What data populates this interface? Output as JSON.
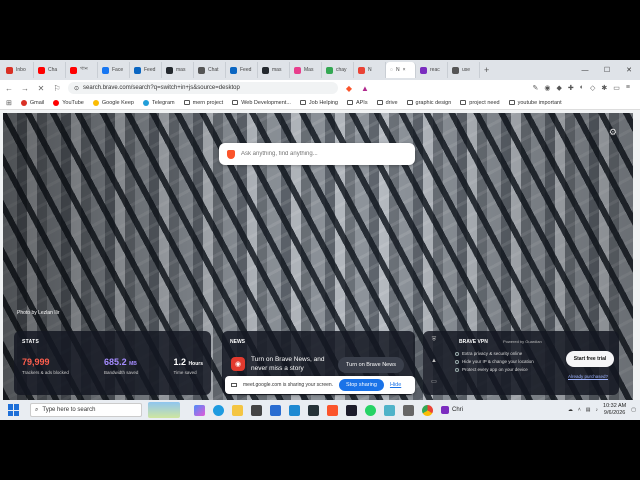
{
  "tabs": [
    {
      "label": "Inbo",
      "color": "#d93025"
    },
    {
      "label": "Cha",
      "color": "#ff0000"
    },
    {
      "label": "গান",
      "color": "#ff0000"
    },
    {
      "label": "Face",
      "color": "#1877f2"
    },
    {
      "label": "Feed",
      "color": "#0a66c2"
    },
    {
      "label": "mas",
      "color": "#24292e"
    },
    {
      "label": "Chat",
      "color": "#555555"
    },
    {
      "label": "Feed",
      "color": "#0a66c2"
    },
    {
      "label": "mas",
      "color": "#24292e"
    },
    {
      "label": "Mas",
      "color": "#e83e8c"
    },
    {
      "label": "chay",
      "color": "#34a853"
    },
    {
      "label": "N",
      "color": "#ea4335"
    },
    {
      "label": "reac",
      "color": "#7b2cbf"
    },
    {
      "label": "use",
      "color": "#555555"
    }
  ],
  "active_tab": {
    "label": "N"
  },
  "window_controls": {
    "minimize": "—",
    "maximize": "☐",
    "close": "✕"
  },
  "address_bar": {
    "url": "search.brave.com/search?q=switch+in+js&source=desktop"
  },
  "bookmarks": [
    {
      "label": "Gmail",
      "icon": "gmail-icon",
      "color": "#d93025"
    },
    {
      "label": "YouTube",
      "icon": "youtube-icon",
      "color": "#ff0000"
    },
    {
      "label": "Google Keep",
      "icon": "keep-icon",
      "color": "#fbbc04"
    },
    {
      "label": "Telegram",
      "icon": "telegram-icon",
      "color": "#229ed9"
    },
    {
      "label": "mern project",
      "icon": "folder-icon",
      "color": ""
    },
    {
      "label": "Web Development...",
      "icon": "folder-icon",
      "color": ""
    },
    {
      "label": "Job Helping",
      "icon": "folder-icon",
      "color": ""
    },
    {
      "label": "APIs",
      "icon": "folder-icon",
      "color": ""
    },
    {
      "label": "drive",
      "icon": "folder-icon",
      "color": ""
    },
    {
      "label": "graphic design",
      "icon": "folder-icon",
      "color": ""
    },
    {
      "label": "project need",
      "icon": "folder-icon",
      "color": ""
    },
    {
      "label": "youtube important",
      "icon": "folder-icon",
      "color": ""
    }
  ],
  "newtab": {
    "search_placeholder": "Ask anything, find anything...",
    "photo_credit": "Photo by Lezlan Ilir",
    "stats": {
      "heading": "STATS",
      "trackers_value": "79,999",
      "trackers_label": "Trackers & ads blocked",
      "bandwidth_value": "685.2",
      "bandwidth_unit": "MB",
      "bandwidth_label": "Bandwidth saved",
      "time_value": "1.2",
      "time_unit": "Hours",
      "time_label": "Time saved",
      "trackers_color": "#ff5e4d",
      "bandwidth_color": "#a58cff"
    },
    "news": {
      "heading": "NEWS",
      "text": "Turn on Brave News, and never miss a story",
      "button": "Turn on Brave News"
    },
    "vpn": {
      "title": "BRAVE VPN",
      "powered_by": "Powered by Guardian",
      "features": [
        "Extra privacy & security online",
        "Hide your IP & change your location",
        "Protect every app on your device"
      ],
      "trial_button": "Start free trial",
      "purchased_link": "Already purchased?"
    }
  },
  "share_bar": {
    "message": "meet.google.com is sharing your screen.",
    "stop_button": "Stop sharing",
    "hide_link": "Hide"
  },
  "taskbar": {
    "search_placeholder": "Type here to search",
    "chrome_label": "Chri",
    "time": "10:32 AM",
    "date": "9/6/2026"
  }
}
